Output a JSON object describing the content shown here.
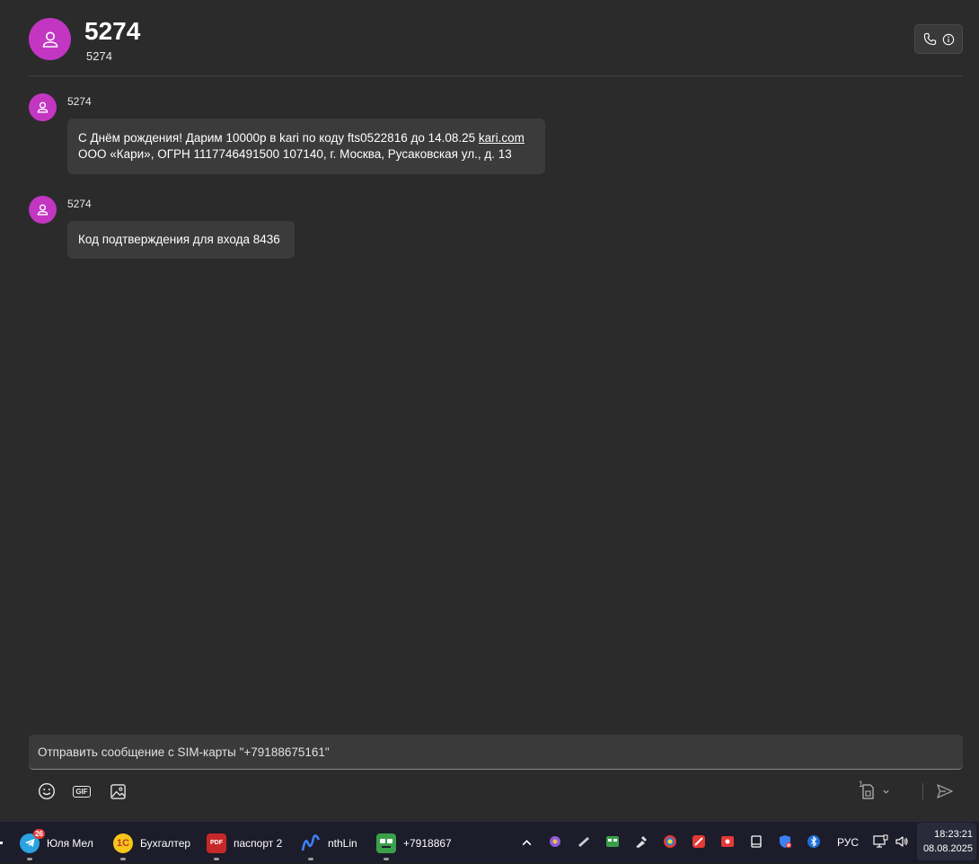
{
  "header": {
    "title": "5274",
    "subtitle": "5274",
    "call_icon": "phone-icon",
    "info_icon": "info-icon",
    "avatar_icon": "person-icon"
  },
  "messages": [
    {
      "sender": "5274",
      "line1_text": "С Днём рождения! Дарим 10000р в kari по коду fts0522816 до 14.08.25 ",
      "line1_link": "kari.com",
      "line2": "ООО «Кари», ОГРН 1117746491500 107140, г. Москва, Русаковская ул., д. 13"
    },
    {
      "sender": "5274",
      "text": "Код подтверждения для входа 8436"
    }
  ],
  "compose": {
    "placeholder": "Отправить сообщение с SIM-карты \"+79188675161\"",
    "emoji_icon": "emoji-icon",
    "gif_label": "GIF",
    "image_icon": "image-icon",
    "sim_label": "1",
    "send_icon": "send-icon"
  },
  "taskbar": {
    "tasks": [
      {
        "label": "Юля Мел",
        "badge": "26",
        "icon": "telegram-icon"
      },
      {
        "label": "Бухгалтер",
        "icon": "1c-icon",
        "icon_text": "1C"
      },
      {
        "label": "паспорт 2",
        "icon": "pdf-icon",
        "icon_text": "PDF"
      },
      {
        "label": "nthLin",
        "icon": "app-icon"
      },
      {
        "label": "+7918867",
        "icon": "phone-link-icon"
      }
    ],
    "lang": "РУС",
    "time": "18:23:21",
    "date": "08.08.2025"
  },
  "colors": {
    "accent": "#c236c2",
    "background": "#2b2b2b",
    "bubble": "#3b3b3b"
  }
}
